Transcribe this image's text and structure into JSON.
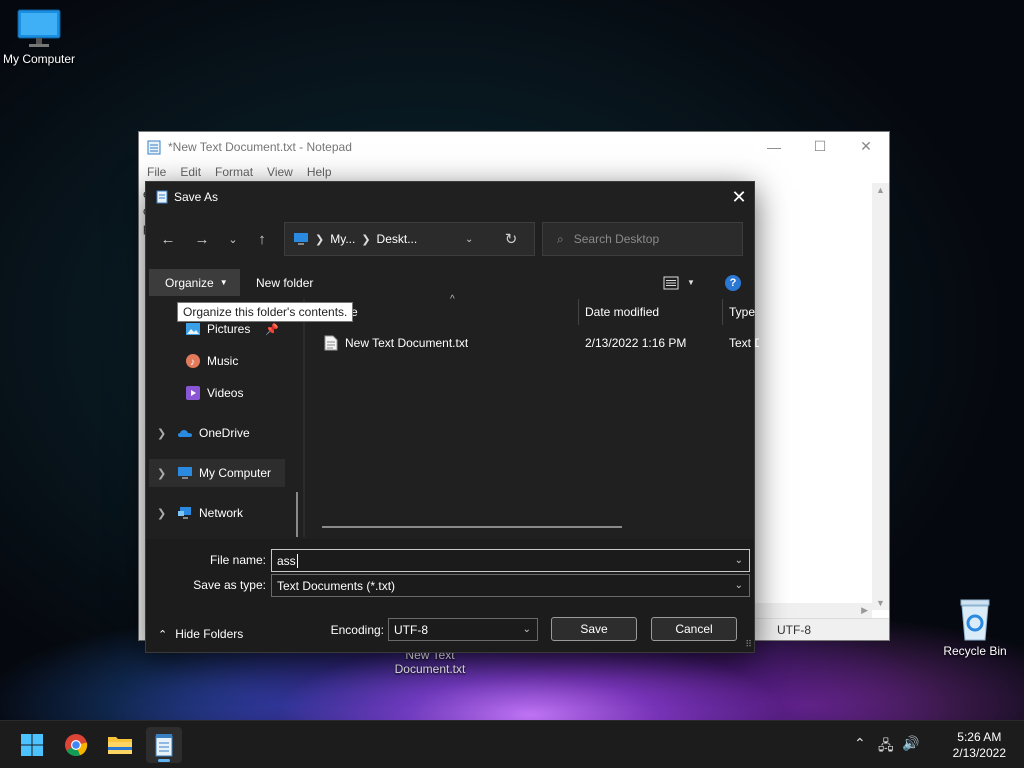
{
  "desktop": {
    "icons": [
      {
        "label": "My Computer"
      },
      {
        "label": "Recycle Bin"
      },
      {
        "label": "New Text Document.txt"
      }
    ]
  },
  "notepad": {
    "title": "*New Text Document.txt - Notepad",
    "menu": [
      "File",
      "Edit",
      "Format",
      "View",
      "Help"
    ],
    "text_lines": [
      "e",
      "c",
      "p"
    ],
    "status_encoding": "UTF-8",
    "caption_buttons": {
      "minimize": "—",
      "maximize": "☐",
      "close": "✕"
    }
  },
  "save_dialog": {
    "title": "Save As",
    "address": {
      "crumb1": "My...",
      "crumb2": "Deskt..."
    },
    "search_placeholder": "Search Desktop",
    "toolbar": {
      "organize": "Organize",
      "new_folder": "New folder"
    },
    "tooltip": "Organize this folder's contents.",
    "nav_items": [
      {
        "label": "Pictures",
        "icon": "pictures-icon"
      },
      {
        "label": "Music",
        "icon": "music-icon"
      },
      {
        "label": "Videos",
        "icon": "videos-icon"
      },
      {
        "label": "OneDrive",
        "icon": "onedrive-icon"
      },
      {
        "label": "My Computer",
        "icon": "computer-icon"
      },
      {
        "label": "Network",
        "icon": "network-icon"
      }
    ],
    "columns": {
      "name": "me",
      "date": "Date modified",
      "type": "Type"
    },
    "files": [
      {
        "name": "New Text Document.txt",
        "date": "2/13/2022 1:16 PM",
        "type": "Text D"
      }
    ],
    "file_name_label": "File name:",
    "file_name_value": "ass",
    "save_type_label": "Save as type:",
    "save_type_value": "Text Documents (*.txt)",
    "hide_folders": "Hide Folders",
    "encoding_label": "Encoding:",
    "encoding_value": "UTF-8",
    "save_button": "Save",
    "cancel_button": "Cancel"
  },
  "taskbar": {
    "clock_time": "5:26 AM",
    "clock_date": "2/13/2022"
  },
  "colors": {
    "accent": "#2a78d4",
    "dialog_bg": "#202020",
    "taskbar_bg": "#1c1c1c"
  }
}
